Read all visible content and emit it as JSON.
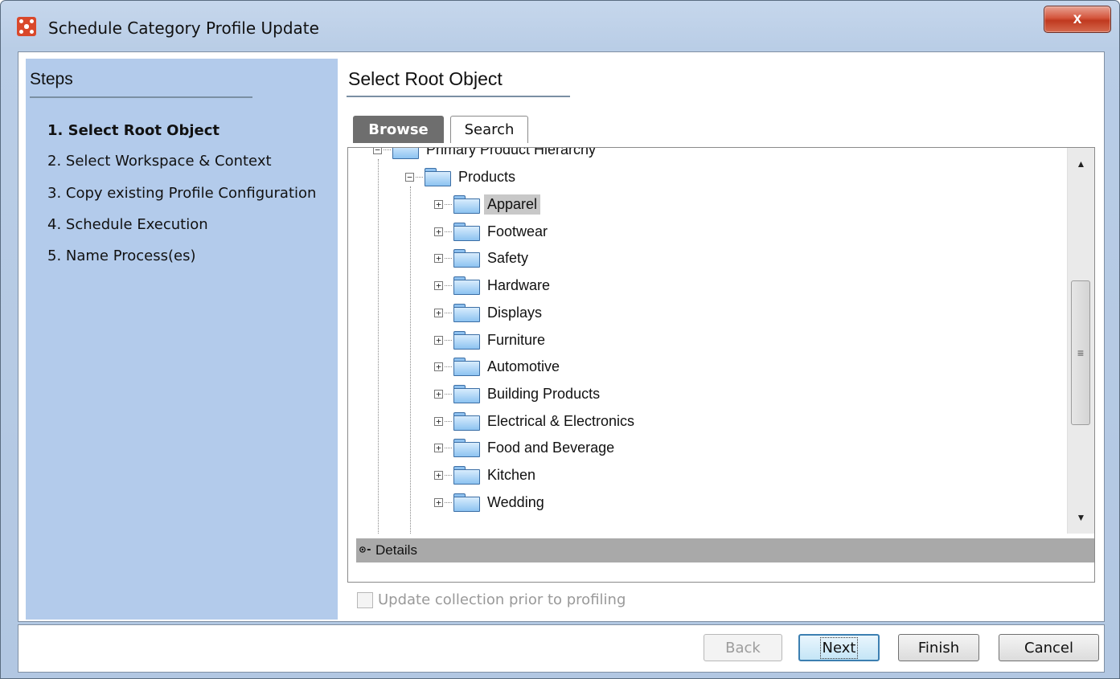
{
  "window": {
    "title": "Schedule Category Profile Update",
    "close_label": "x"
  },
  "steps": {
    "title": "Steps",
    "items": [
      {
        "label": "1. Select Root Object",
        "active": true
      },
      {
        "label": "2. Select Workspace & Context",
        "active": false
      },
      {
        "label": "3. Copy existing Profile Configuration",
        "active": false
      },
      {
        "label": "4. Schedule Execution",
        "active": false
      },
      {
        "label": "5. Name Process(es)",
        "active": false
      }
    ]
  },
  "main": {
    "title": "Select Root Object",
    "tabs": [
      {
        "label": "Browse",
        "selected": true
      },
      {
        "label": "Search",
        "selected": false
      }
    ]
  },
  "tree": {
    "root": {
      "label": "Primary Product Hierarchy",
      "expander": "−"
    },
    "products": {
      "label": "Products",
      "expander": "−"
    },
    "children_expander": "+",
    "children": [
      "Apparel",
      "Footwear",
      "Safety",
      "Hardware",
      "Displays",
      "Furniture",
      "Automotive",
      "Building Products",
      "Electrical & Electronics",
      "Food and Beverage",
      "Kitchen",
      "Wedding"
    ],
    "selected": "Apparel",
    "scroll_up": "▲",
    "scroll_down": "▼",
    "scroll_grip": "≡"
  },
  "details": {
    "toggle_icon": "⊙-",
    "label": "Details"
  },
  "update_checkbox": {
    "label": "Update collection prior to profiling",
    "checked": false,
    "enabled": false
  },
  "footer": {
    "back_label": "Back",
    "next_label": "Next",
    "finish_label": "Finish",
    "cancel_label": "Cancel"
  }
}
